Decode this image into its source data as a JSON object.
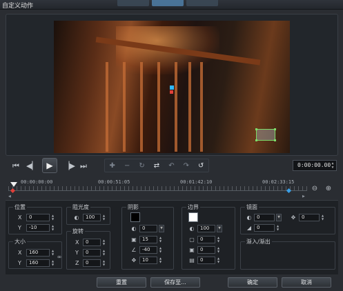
{
  "window": {
    "title": "自定义动作"
  },
  "transport": {
    "timecode": "0:00:00.00"
  },
  "timeline": {
    "labels": [
      "00:00:00:00",
      "00:00:51:05",
      "00:01:42:10",
      "00:02:33:15"
    ]
  },
  "position": {
    "title": "位置",
    "x_label": "X",
    "x_value": "0",
    "y_label": "Y",
    "y_value": "-10"
  },
  "size": {
    "title": "大小",
    "x_label": "X",
    "x_value": "160",
    "y_label": "Y",
    "y_value": "160"
  },
  "opacity": {
    "title": "阻光度",
    "value": "100"
  },
  "rotation": {
    "title": "旋转",
    "x_label": "X",
    "x_value": "0",
    "y_label": "Y",
    "y_value": "0",
    "z_label": "Z",
    "z_value": "0"
  },
  "shadow": {
    "title": "阴影",
    "color": "#000000",
    "opacity": "0",
    "blur": "15",
    "angle": "-40",
    "distance": "10"
  },
  "border": {
    "title": "边界",
    "color": "#ffffff",
    "opacity": "100",
    "width": "0",
    "v2": "0",
    "v3": "0"
  },
  "mirror": {
    "title": "镜面",
    "v1": "0",
    "v2": "0",
    "v3": "0"
  },
  "fade": {
    "title": "渐入/渐出"
  },
  "footer": {
    "reset": "重置",
    "save_as": "保存至...",
    "ok": "确定",
    "cancel": "取消"
  },
  "colors": {
    "accent": "#4f7fa8",
    "keyframe_red": "#e0403a",
    "keyframe_blue": "#3aa0e8",
    "mask_green": "#7ddc6a"
  }
}
